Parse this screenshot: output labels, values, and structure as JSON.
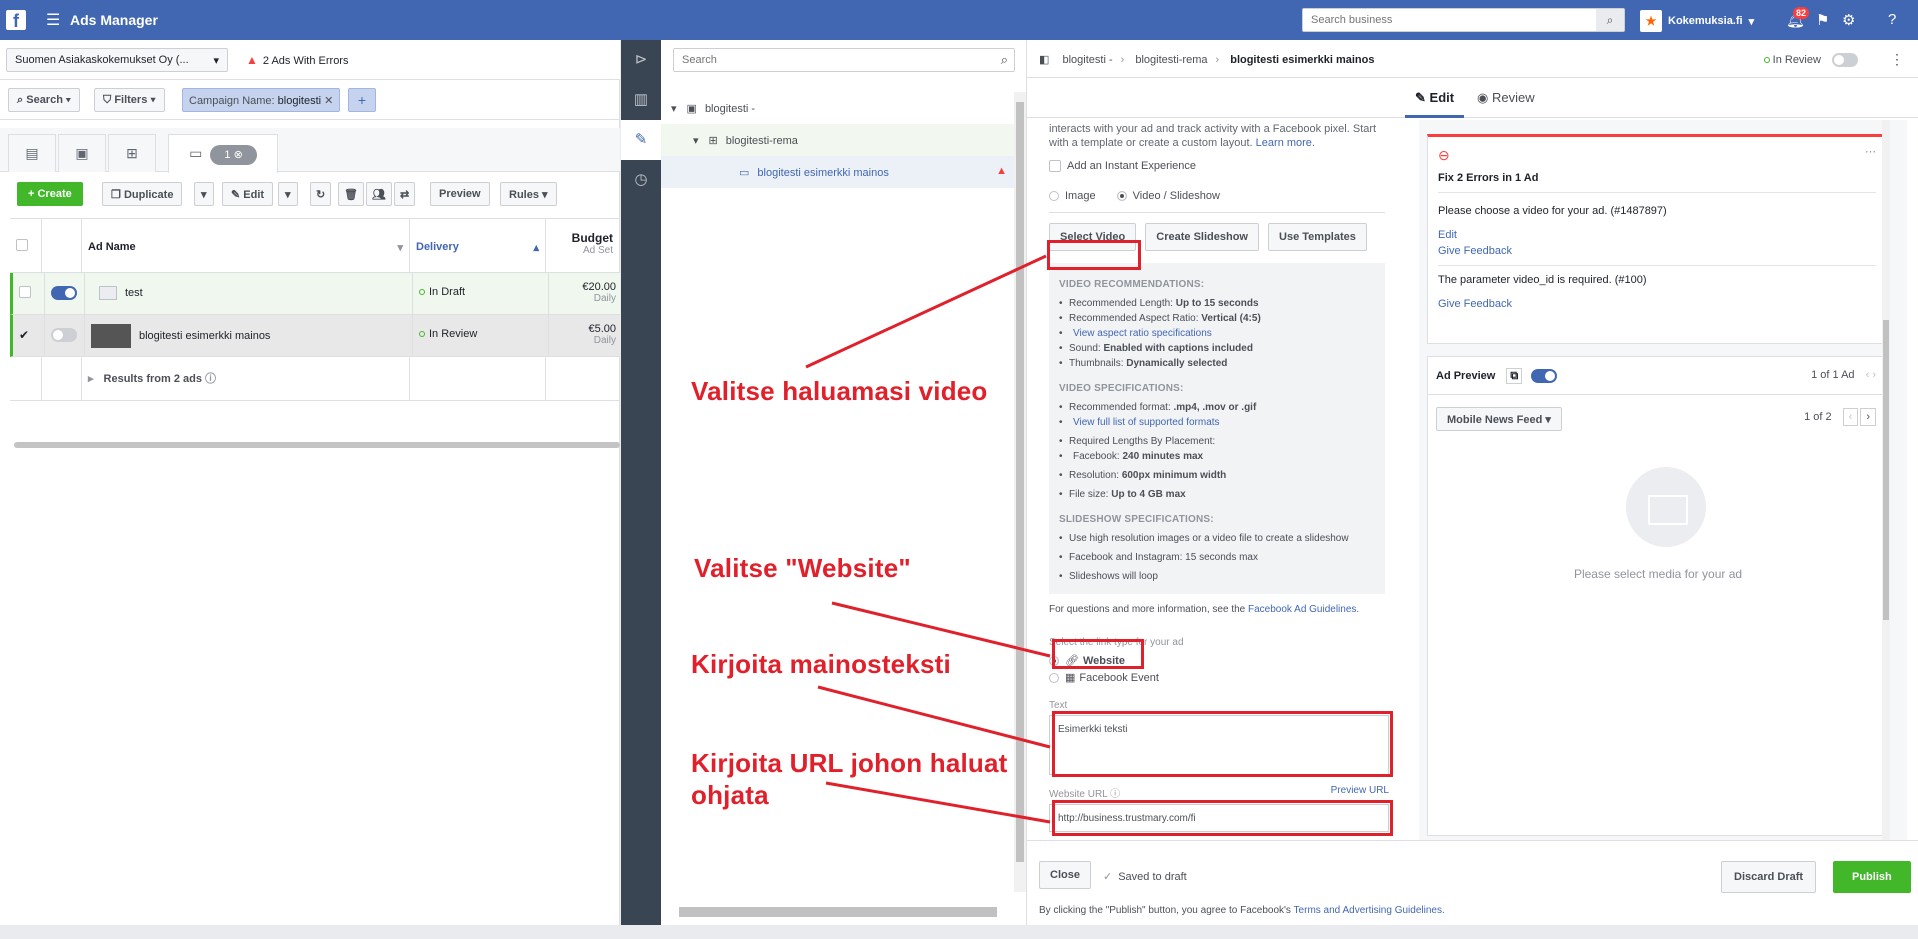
{
  "topbar": {
    "app_title": "Ads Manager",
    "search_placeholder": "Search business",
    "account_name": "Kokemuksia.fi",
    "notifications": "82"
  },
  "account_bar": {
    "account": "Suomen Asiakaskokemukset Oy (...",
    "errors": "2 Ads With Errors"
  },
  "filters": {
    "search": "Search",
    "filters": "Filters",
    "chip_label": "Campaign Name:",
    "chip_value": "blogitesti"
  },
  "tabs": {
    "count": "1"
  },
  "actions": {
    "create": "Create",
    "duplicate": "Duplicate",
    "edit": "Edit",
    "preview": "Preview",
    "rules": "Rules"
  },
  "grid": {
    "headers": {
      "name": "Ad Name",
      "delivery": "Delivery",
      "budget": "Budget",
      "budget_sub": "Ad Set"
    },
    "rows": [
      {
        "name": "test",
        "delivery": "In Draft",
        "budget": "€20.00",
        "period": "Daily"
      },
      {
        "name": "blogitesti esimerkki mainos",
        "delivery": "In Review",
        "budget": "€5.00",
        "period": "Daily"
      }
    ],
    "results": "Results from 2 ads"
  },
  "tree": {
    "search_placeholder": "Search",
    "campaign": "blogitesti -",
    "adset": "blogitesti-rema",
    "ad": "blogitesti esimerkki mainos"
  },
  "editor": {
    "crumbs": [
      "blogitesti -",
      "blogitesti-rema",
      "blogitesti esimerkki mainos"
    ],
    "status": "In Review",
    "tab_edit": "Edit",
    "tab_review": "Review",
    "intro_text": "interacts with your ad and track activity with a Facebook pixel. Start with a template or create a custom layout.",
    "learn_more": "Learn more.",
    "instant_exp": "Add an Instant Experience",
    "format_image": "Image",
    "format_video": "Video / Slideshow",
    "select_video": "Select Video",
    "create_slideshow": "Create Slideshow",
    "use_templates": "Use Templates",
    "rec_title": "VIDEO RECOMMENDATIONS:",
    "rec_length": "Recommended Length:",
    "rec_length_v": "Up to 15 seconds",
    "rec_ratio": "Recommended Aspect Ratio:",
    "rec_ratio_v": "Vertical (4:5)",
    "rec_ratio_link": "View aspect ratio specifications",
    "rec_sound": "Sound:",
    "rec_sound_v": "Enabled with captions included",
    "rec_thumb": "Thumbnails:",
    "rec_thumb_v": "Dynamically selected",
    "spec_title": "VIDEO SPECIFICATIONS:",
    "spec_format": "Recommended format:",
    "spec_format_v": ".mp4, .mov or .gif",
    "spec_format_link": "View full list of supported formats",
    "spec_lengths": "Required Lengths By Placement:",
    "spec_fb": "Facebook:",
    "spec_fb_v": "240 minutes max",
    "spec_res": "Resolution:",
    "spec_res_v": "600px minimum width",
    "spec_size": "File size:",
    "spec_size_v": "Up to 4 GB max",
    "ss_title": "SLIDESHOW SPECIFICATIONS:",
    "ss_1": "Use high resolution images or a video file to create a slideshow",
    "ss_2": "Facebook and Instagram: 15 seconds max",
    "ss_3": "Slideshows will loop",
    "questions": "For questions and more information, see the",
    "guidelines": "Facebook Ad Guidelines.",
    "link_type_label": "Select the link type for your ad",
    "link_website": "Website",
    "link_event": "Facebook Event",
    "text_label": "Text",
    "text_value": "Esimerkki teksti",
    "url_label": "Website URL",
    "preview_url": "Preview URL",
    "url_value": "http://business.trustmary.com/fi"
  },
  "errors_card": {
    "title": "Fix 2 Errors in 1 Ad",
    "err1": "Please choose a video for your ad. (#1487897)",
    "edit": "Edit",
    "feedback": "Give Feedback",
    "err2": "The parameter video_id is required. (#100)"
  },
  "preview": {
    "title": "Ad Preview",
    "count": "1 of 1 Ad",
    "placement": "Mobile News Feed",
    "page": "1 of 2",
    "placeholder": "Please select media for your ad"
  },
  "footer": {
    "close": "Close",
    "saved": "Saved to draft",
    "discard": "Discard Draft",
    "publish": "Publish",
    "terms": "By clicking the \"Publish\" button, you agree to Facebook's",
    "terms_link": "Terms and Advertising Guidelines."
  },
  "annotations": {
    "a1": "Valitse haluamasi video",
    "a2": "Valitse \"Website\"",
    "a3": "Kirjoita mainosteksti",
    "a4": "Kirjoita URL johon haluat ohjata"
  },
  "colors": {
    "brand": "#4267b2",
    "accent_red": "#e0202a",
    "green": "#42b72a"
  }
}
